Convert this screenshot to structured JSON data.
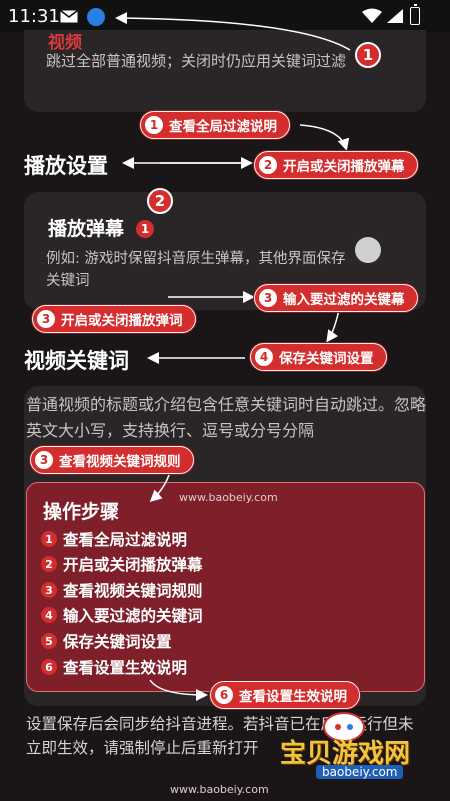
{
  "status_bar": {
    "time": "11:31"
  },
  "filter_card": {
    "faded_title": "视频",
    "description": "跳过全部普通视频；关闭时仍应用关键词过滤"
  },
  "playback": {
    "section_title": "播放设置",
    "danmaku_title": "播放弹幕",
    "danmaku_desc": "例如: 游戏时保留抖音原生弹幕，其他界面保存关键词",
    "toggle_state": "off"
  },
  "keywords": {
    "section_title": "视频关键词",
    "description": "普通视频的标题或介绍包含任意关键词时自动跳过。忽略英文大小写，支持换行、逗号或分号分隔"
  },
  "annotations": {
    "big_1": "1",
    "big_2": "2",
    "inline_1": "1",
    "pill_view_global": {
      "num": "1",
      "label": "查看全局过滤说明"
    },
    "pill_toggle_danmaku": {
      "num": "2",
      "label": "开启或关闭播放弹幕"
    },
    "pill_input_keywords": {
      "num": "3",
      "label": "输入要过滤的关键幕"
    },
    "pill_toggle_danmaku_left": {
      "num": "3",
      "label": "开启或关闭播放弹词"
    },
    "pill_save_keywords": {
      "num": "4",
      "label": "保存关键词设置"
    },
    "pill_view_rules": {
      "num": "3",
      "label": "查看视频关键词规则"
    },
    "pill_view_effective": {
      "num": "6",
      "label": "查看设置生效说明"
    }
  },
  "steps": {
    "title": "操作步骤",
    "watermark": "www.baobeiy.com",
    "items": [
      {
        "num": "1",
        "label": "查看全局过滤说明"
      },
      {
        "num": "2",
        "label": "开启或关闭播放弹幕"
      },
      {
        "num": "3",
        "label": "查看视频关键词规则"
      },
      {
        "num": "4",
        "label": "输入要过滤的关键词"
      },
      {
        "num": "5",
        "label": "保存关键词设置"
      },
      {
        "num": "6",
        "label": "查看设置生效说明"
      }
    ]
  },
  "footer": {
    "description": "设置保存后会同步给抖音进程。若抖音已在后台运行但未立即生效，请强制停止后重新打开",
    "logo_text": "宝贝游戏网",
    "logo_sub": "baobeiy.com",
    "watermark": "www.baobeiy.com"
  },
  "colors": {
    "accent": "#d32d2d",
    "background": "#1a1618",
    "card": "#2a2628",
    "steps_box": "#7e1f2a"
  }
}
